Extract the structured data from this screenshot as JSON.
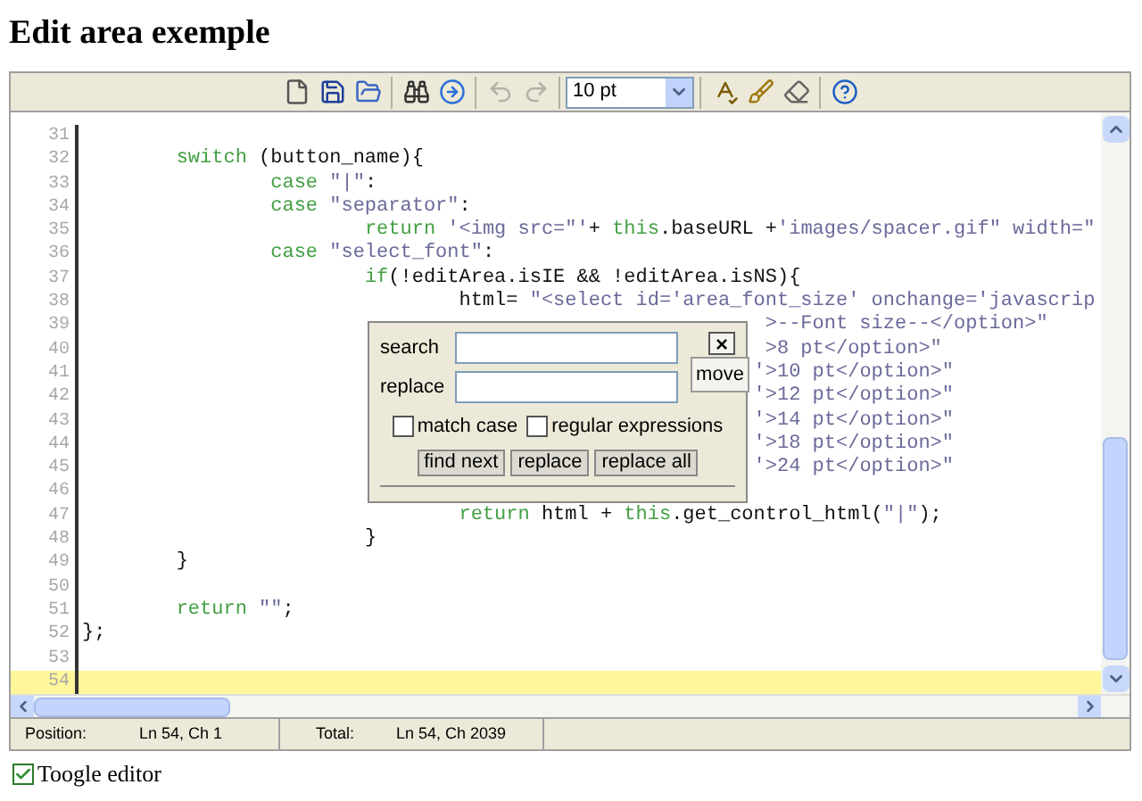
{
  "page": {
    "title": "Edit area exemple"
  },
  "toolbar": {
    "buttons": [
      {
        "kind": "new",
        "disabled": false
      },
      {
        "kind": "save",
        "disabled": false
      },
      {
        "kind": "open",
        "disabled": false
      },
      {
        "kind": "sep"
      },
      {
        "kind": "search",
        "disabled": false
      },
      {
        "kind": "goto",
        "disabled": false
      },
      {
        "kind": "sep"
      },
      {
        "kind": "undo",
        "disabled": true
      },
      {
        "kind": "redo",
        "disabled": true
      },
      {
        "kind": "sep"
      },
      {
        "kind": "font",
        "value": "10 pt"
      },
      {
        "kind": "sep"
      },
      {
        "kind": "spell",
        "disabled": false
      },
      {
        "kind": "highlight",
        "disabled": false
      },
      {
        "kind": "reset",
        "disabled": false
      },
      {
        "kind": "sep"
      },
      {
        "kind": "help",
        "disabled": false
      }
    ]
  },
  "editor": {
    "lines": [
      {
        "number": "31",
        "selected": false
      },
      {
        "number": "32",
        "selected": false,
        "segments": [
          {
            "kind": "kw",
            "text": "\tswitch"
          },
          {
            "kind": "plain",
            "text": " (button_name){"
          }
        ]
      },
      {
        "number": "33",
        "selected": false,
        "segments": [
          {
            "kind": "kw",
            "text": "\t\tcase"
          },
          {
            "kind": "str",
            "text": " \"|\""
          },
          {
            "kind": "plain",
            "text": ":"
          }
        ]
      },
      {
        "number": "34",
        "selected": false,
        "segments": [
          {
            "kind": "kw",
            "text": "\t\tcase"
          },
          {
            "kind": "str",
            "text": " \"separator\""
          },
          {
            "kind": "plain",
            "text": ":"
          }
        ]
      },
      {
        "number": "35",
        "selected": false,
        "segments": [
          {
            "kind": "kw",
            "text": "\t\t\treturn"
          },
          {
            "kind": "str",
            "text": " '<img src=\"'"
          },
          {
            "kind": "plain",
            "text": "+ "
          },
          {
            "kind": "kw",
            "text": "this"
          },
          {
            "kind": "plain",
            "text": ".baseURL +"
          },
          {
            "kind": "str",
            "text": "'images/spacer.gif\" width=\""
          }
        ]
      },
      {
        "number": "36",
        "selected": false,
        "segments": [
          {
            "kind": "kw",
            "text": "\t\tcase"
          },
          {
            "kind": "str",
            "text": " \"select_font\""
          },
          {
            "kind": "plain",
            "text": ":"
          }
        ]
      },
      {
        "number": "37",
        "selected": false,
        "segments": [
          {
            "kind": "kw",
            "text": "\t\t\tif"
          },
          {
            "kind": "plain",
            "text": "(!editArea.isIE && !editArea.isNS){"
          }
        ]
      },
      {
        "number": "38",
        "selected": false,
        "segments": [
          {
            "kind": "plain",
            "text": "\t\t\t\thtml= "
          },
          {
            "kind": "str",
            "text": "\"<select id='area_font_size' onchange='javascrip"
          }
        ]
      },
      {
        "number": "39",
        "selected": false,
        "segments": [
          {
            "kind": "str",
            "text": "\t\t\t\t\t\t\t  >--Font size--</option>\""
          }
        ]
      },
      {
        "number": "40",
        "selected": false,
        "segments": [
          {
            "kind": "str",
            "text": "\t\t\t\t\t\t\t  >8 pt</option>\""
          }
        ]
      },
      {
        "number": "41",
        "selected": false,
        "segments": [
          {
            "kind": "str",
            "text": "\t\t\t\t\t\t\t '>10 pt</option>\""
          }
        ]
      },
      {
        "number": "42",
        "selected": false,
        "segments": [
          {
            "kind": "str",
            "text": "\t\t\t\t\t\t\t '>12 pt</option>\""
          }
        ]
      },
      {
        "number": "43",
        "selected": false,
        "segments": [
          {
            "kind": "str",
            "text": "\t\t\t\t\t\t\t '>14 pt</option>\""
          }
        ]
      },
      {
        "number": "44",
        "selected": false,
        "segments": [
          {
            "kind": "str",
            "text": "\t\t\t\t\t\t\t '>18 pt</option>\""
          }
        ]
      },
      {
        "number": "45",
        "selected": false,
        "segments": [
          {
            "kind": "str",
            "text": "\t\t\t\t\t\t\t '>24 pt</option>\""
          }
        ]
      },
      {
        "number": "46",
        "selected": false
      },
      {
        "number": "47",
        "selected": false,
        "segments": [
          {
            "kind": "kw",
            "text": "\t\t\t\treturn"
          },
          {
            "kind": "plain",
            "text": " html + "
          },
          {
            "kind": "kw",
            "text": "this"
          },
          {
            "kind": "plain",
            "text": ".get_control_html("
          },
          {
            "kind": "str",
            "text": "\"|\""
          },
          {
            "kind": "plain",
            "text": ");"
          }
        ]
      },
      {
        "number": "48",
        "selected": false,
        "segments": [
          {
            "kind": "plain",
            "text": "\t\t\t}"
          }
        ]
      },
      {
        "number": "49",
        "selected": false,
        "segments": [
          {
            "kind": "plain",
            "text": "\t}"
          }
        ]
      },
      {
        "number": "50",
        "selected": false
      },
      {
        "number": "51",
        "selected": false,
        "segments": [
          {
            "kind": "kw",
            "text": "\treturn"
          },
          {
            "kind": "str",
            "text": " \"\""
          },
          {
            "kind": "plain",
            "text": ";"
          }
        ]
      },
      {
        "number": "52",
        "selected": false,
        "segments": [
          {
            "kind": "plain",
            "text": "};"
          }
        ]
      },
      {
        "number": "53",
        "selected": false
      },
      {
        "number": "54",
        "selected": true
      }
    ]
  },
  "find_dialog": {
    "close": "×",
    "search_label": "search",
    "replace_label": "replace",
    "move": "move",
    "options": [
      {
        "label": "match case",
        "checked": false
      },
      {
        "label": "regular expressions",
        "checked": false
      }
    ],
    "buttons": [
      "find next",
      "replace",
      "replace all"
    ]
  },
  "status_bar": {
    "position_label": "Position:",
    "position": "Ln 54, Ch 1",
    "total_label": "Total:",
    "total": "Ln 54, Ch 2039"
  },
  "toggle": {
    "label": "Toogle editor",
    "checked": true
  }
}
